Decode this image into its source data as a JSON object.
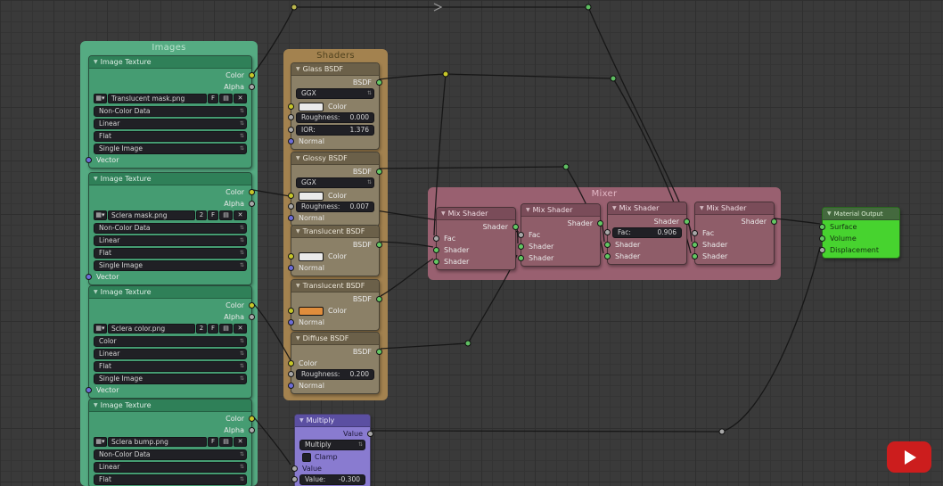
{
  "icons": {
    "collapse": "▼",
    "image": "▦",
    "caret": "▾",
    "open": "▤",
    "unlink": "✕"
  },
  "frames": {
    "images": "Images",
    "shaders": "Shaders",
    "mixer": "Mixer"
  },
  "colors": {
    "images_frame": "#55ab82",
    "shaders_frame": "#a3824f",
    "mixer_frame": "#996070",
    "material_output_body": "#47d32f",
    "multiply_body": "#897bd0",
    "translucent2_swatch": "#e08d3c",
    "youtube_red": "#cc1d1d",
    "socket_color": "#c7c729",
    "socket_shader": "#63c763",
    "socket_vector": "#6d6dd8",
    "socket_value": "#a8a8a8"
  },
  "image_textures": [
    {
      "title": "Image Texture",
      "out_color": "Color",
      "out_alpha": "Alpha",
      "filename": "Translucent mask.png",
      "fake": "F",
      "color_space": "Non-Color Data",
      "interpolation": "Linear",
      "projection": "Flat",
      "source": "Single Image",
      "in_vector": "Vector"
    },
    {
      "title": "Image Texture",
      "out_color": "Color",
      "out_alpha": "Alpha",
      "filename": "Sclera mask.png",
      "users": "2",
      "fake": "F",
      "color_space": "Non-Color Data",
      "interpolation": "Linear",
      "projection": "Flat",
      "source": "Single Image",
      "in_vector": "Vector"
    },
    {
      "title": "Image Texture",
      "out_color": "Color",
      "out_alpha": "Alpha",
      "filename": "Sclera color.png",
      "users": "2",
      "fake": "F",
      "color_space": "Color",
      "interpolation": "Linear",
      "projection": "Flat",
      "source": "Single Image",
      "in_vector": "Vector"
    },
    {
      "title": "Image Texture",
      "out_color": "Color",
      "out_alpha": "Alpha",
      "filename": "Sclera bump.png",
      "fake": "F",
      "color_space": "Non-Color Data",
      "interpolation": "Linear",
      "projection": "Flat"
    }
  ],
  "glass": {
    "title": "Glass BSDF",
    "out": "BSDF",
    "distribution": "GGX",
    "color": "Color",
    "roughness_label": "Roughness:",
    "roughness_value": "0.000",
    "ior_label": "IOR:",
    "ior_value": "1.376",
    "normal": "Normal"
  },
  "glossy": {
    "title": "Glossy BSDF",
    "out": "BSDF",
    "distribution": "GGX",
    "color": "Color",
    "roughness_label": "Roughness:",
    "roughness_value": "0.007",
    "normal": "Normal"
  },
  "translucent1": {
    "title": "Translucent BSDF",
    "out": "BSDF",
    "color": "Color",
    "normal": "Normal"
  },
  "translucent2": {
    "title": "Translucent BSDF",
    "out": "BSDF",
    "color": "Color",
    "normal": "Normal"
  },
  "diffuse": {
    "title": "Diffuse BSDF",
    "out": "BSDF",
    "color": "Color",
    "roughness_label": "Roughness:",
    "roughness_value": "0.200",
    "normal": "Normal"
  },
  "mixers": [
    {
      "title": "Mix Shader",
      "out": "Shader",
      "fac": "Fac",
      "shader1": "Shader",
      "shader2": "Shader"
    },
    {
      "title": "Mix Shader",
      "out": "Shader",
      "fac": "Fac",
      "shader1": "Shader",
      "shader2": "Shader"
    },
    {
      "title": "Mix Shader",
      "out": "Shader",
      "fac_label": "Fac:",
      "fac_value": "0.906",
      "shader1": "Shader",
      "shader2": "Shader"
    },
    {
      "title": "Mix Shader",
      "out": "Shader",
      "fac": "Fac",
      "shader1": "Shader",
      "shader2": "Shader"
    }
  ],
  "material_output": {
    "title": "Material Output",
    "surface": "Surface",
    "volume": "Volume",
    "displacement": "Displacement"
  },
  "multiply": {
    "title": "Multiply",
    "out": "Value",
    "operation": "Multiply",
    "clamp": "Clamp",
    "value_in": "Value",
    "value_label": "Value:",
    "value_value": "-0.300"
  }
}
